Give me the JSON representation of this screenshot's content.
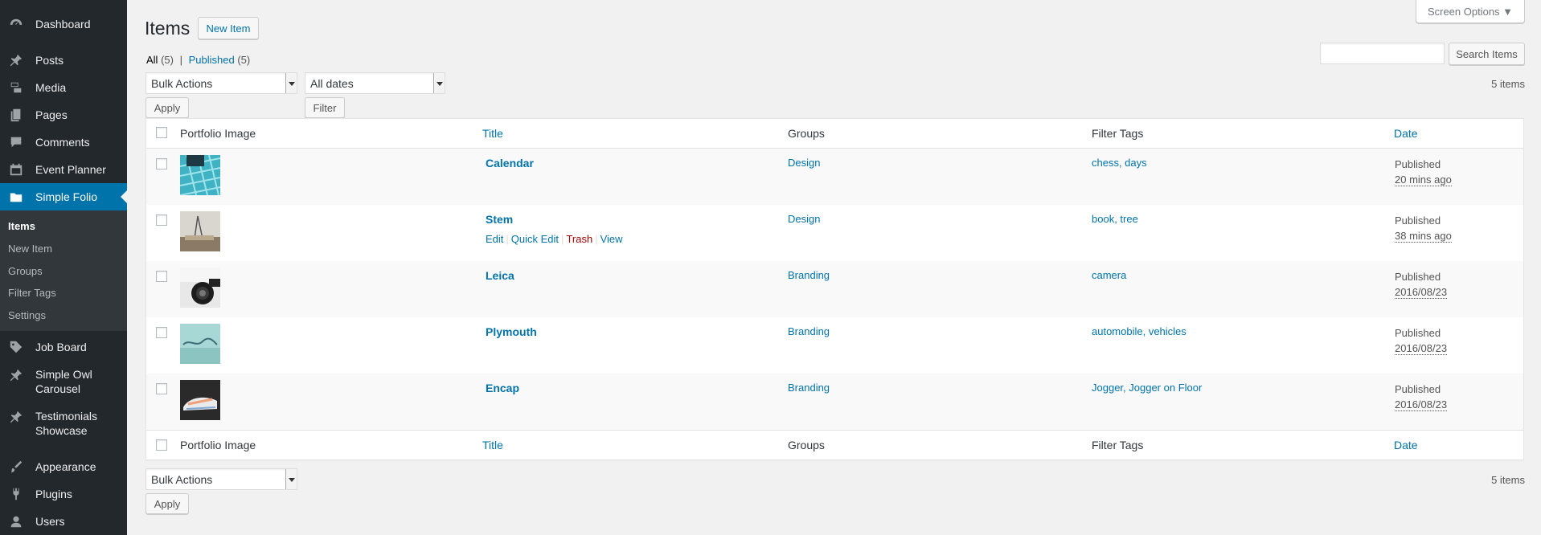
{
  "sidebar": {
    "dashboard": "Dashboard",
    "posts": "Posts",
    "media": "Media",
    "pages": "Pages",
    "comments": "Comments",
    "event_planner": "Event Planner",
    "simple_folio": "Simple Folio",
    "sub": {
      "items": "Items",
      "new_item": "New Item",
      "groups": "Groups",
      "filter_tags": "Filter Tags",
      "settings": "Settings"
    },
    "job_board": "Job Board",
    "simple_owl_1": "Simple Owl",
    "simple_owl_2": "Carousel",
    "testimonials_1": "Testimonials",
    "testimonials_2": "Showcase",
    "appearance": "Appearance",
    "plugins": "Plugins",
    "users": "Users"
  },
  "header": {
    "title": "Items",
    "new_item": "New Item",
    "screen_options": "Screen Options ▼"
  },
  "views": {
    "all": "All",
    "all_count": "(5)",
    "sep": "|",
    "published": "Published",
    "published_count": "(5)"
  },
  "search": {
    "button": "Search Items",
    "value": ""
  },
  "filters": {
    "bulk_actions": "Bulk Actions",
    "apply": "Apply",
    "dates": "All dates",
    "filter": "Filter",
    "count": "5 items"
  },
  "columns": {
    "image": "Portfolio Image",
    "title": "Title",
    "groups": "Groups",
    "tags": "Filter Tags",
    "date": "Date"
  },
  "rows": [
    {
      "title": "Calendar",
      "group": "Design",
      "tags": "chess, days",
      "status": "Published",
      "date": "20 mins ago"
    },
    {
      "title": "Stem",
      "group": "Design",
      "tags": "book, tree",
      "status": "Published",
      "date": "38 mins ago"
    },
    {
      "title": "Leica",
      "group": "Branding",
      "tags": "camera",
      "status": "Published",
      "date": "2016/08/23"
    },
    {
      "title": "Plymouth",
      "group": "Branding",
      "tags": "automobile, vehicles",
      "status": "Published",
      "date": "2016/08/23"
    },
    {
      "title": "Encap",
      "group": "Branding",
      "tags": "Jogger, Jogger on Floor",
      "status": "Published",
      "date": "2016/08/23"
    }
  ],
  "row_actions": {
    "edit": "Edit",
    "quick_edit": "Quick Edit",
    "trash": "Trash",
    "view": "View"
  },
  "colors": {
    "accent": "#0073aa",
    "sidebar": "#23282d",
    "trash": "#a00"
  }
}
